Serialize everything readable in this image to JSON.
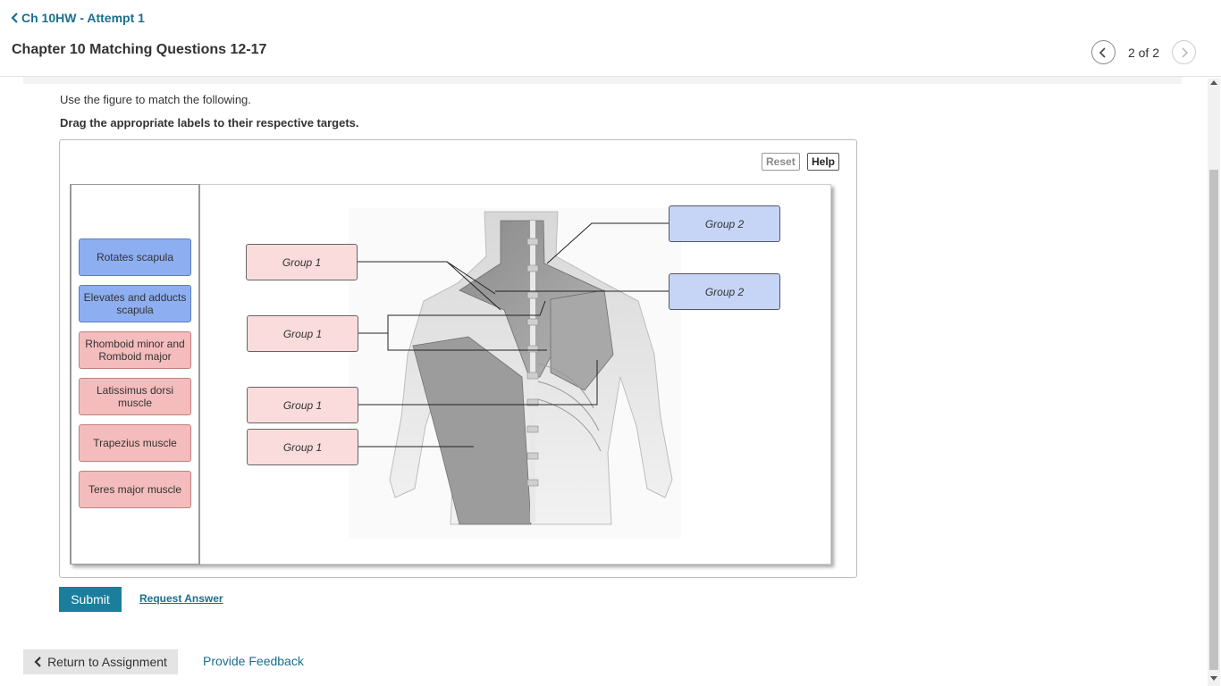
{
  "header": {
    "back_link": "Ch 10HW - Attempt 1",
    "page_title": "Chapter 10 Matching Questions 12-17",
    "pager_text": "2 of 2"
  },
  "instructions": {
    "line1": "Use the figure to match the following.",
    "line2": "Drag the appropriate labels to their respective targets."
  },
  "toolbar": {
    "reset_label": "Reset",
    "help_label": "Help"
  },
  "labels": [
    {
      "text": "Rotates scapula",
      "color": "blue"
    },
    {
      "text": "Elevates and adducts scapula",
      "color": "blue"
    },
    {
      "text": "Rhomboid minor and Romboid major",
      "color": "pink"
    },
    {
      "text": "Latissimus dorsi muscle",
      "color": "pink"
    },
    {
      "text": "Trapezius muscle",
      "color": "pink"
    },
    {
      "text": "Teres major muscle",
      "color": "pink"
    }
  ],
  "targets": [
    {
      "text": "Group 1"
    },
    {
      "text": "Group 1"
    },
    {
      "text": "Group 1"
    },
    {
      "text": "Group 1"
    },
    {
      "text": "Group 2"
    },
    {
      "text": "Group 2"
    }
  ],
  "actions": {
    "submit_label": "Submit",
    "request_answer_label": "Request Answer",
    "return_label": "Return to Assignment",
    "feedback_label": "Provide Feedback"
  },
  "colors": {
    "accent": "#1b7e9c",
    "link": "#1b6f8e",
    "blue_label": "#8daef0",
    "pink_label": "#f4bcbc",
    "blue_target": "#c6d5f5",
    "pink_target": "#fadcdc"
  },
  "icons": {
    "back": "chevron-left-icon",
    "prev": "chevron-left-icon",
    "next": "chevron-right-icon"
  }
}
